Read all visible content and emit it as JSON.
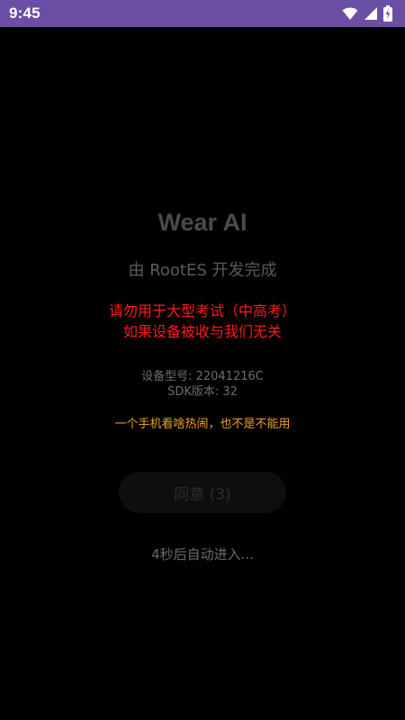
{
  "status_bar": {
    "time": "9:45",
    "icons": [
      "wifi-icon",
      "cellular-signal-icon",
      "battery-charging-icon"
    ],
    "background": "#6a4fa5"
  },
  "app": {
    "title": "Wear AI",
    "subtitle": "由 RootES 开发完成"
  },
  "warning": {
    "line1": "请勿用于大型考试（中高考）",
    "line2": "如果设备被收与我们无关",
    "color": "#ff1a1a"
  },
  "device_info": {
    "model": "设备型号: 22041216C",
    "sdk": "SDK版本: 32"
  },
  "tagline": {
    "text": "一个手机看啥热闹，也不是不能用",
    "color": "#f0a020"
  },
  "agree_button": {
    "label": "同意 (3)"
  },
  "countdown": {
    "text": "4秒后自动进入..."
  }
}
